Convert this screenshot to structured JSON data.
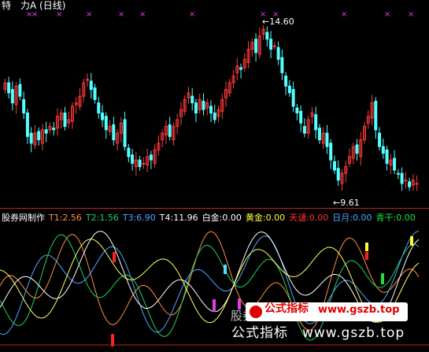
{
  "top_title": "特　力A (日线)",
  "high_label": "14.60",
  "low_label": "9.61",
  "indicator_header": [
    {
      "text": "股券网制作",
      "color": "#ffffff"
    },
    {
      "text": "T1:2.56",
      "color": "#ff9040"
    },
    {
      "text": "T2:1.56",
      "color": "#20d060"
    },
    {
      "text": "T3:6.90",
      "color": "#4fa8ff"
    },
    {
      "text": "T4:11.96",
      "color": "#ffffff"
    },
    {
      "text": "白金:0.00",
      "color": "#ffffff"
    },
    {
      "text": "黄金:0.00",
      "color": "#ffff40"
    },
    {
      "text": "天谴:0.00",
      "color": "#ff3030"
    },
    {
      "text": "日月:0.00",
      "color": "#4fa8ff"
    },
    {
      "text": "青干:0.00",
      "color": "#20e040"
    }
  ],
  "chart_data": {
    "type": "candlestick",
    "price_high": 14.6,
    "price_low": 9.61,
    "closes": [
      12.9,
      12.6,
      12.3,
      12.8,
      12.5,
      12.0,
      11.3,
      11.1,
      11.4,
      11.2,
      11.5,
      11.4,
      11.6,
      11.5,
      11.9,
      12.0,
      11.6,
      11.8,
      12.2,
      12.3,
      12.5,
      12.9,
      13.0,
      12.7,
      12.4,
      12.0,
      11.8,
      11.5,
      11.6,
      11.2,
      11.4,
      11.7,
      11.0,
      10.7,
      10.5,
      10.6,
      10.4,
      10.5,
      10.7,
      10.6,
      10.9,
      11.1,
      11.4,
      11.6,
      11.3,
      11.6,
      11.8,
      12.1,
      12.4,
      12.6,
      12.3,
      12.0,
      12.4,
      12.1,
      12.3,
      12.0,
      11.8,
      12.1,
      12.4,
      12.7,
      12.9,
      13.1,
      13.4,
      13.3,
      13.6,
      13.9,
      14.1,
      13.8,
      14.3,
      14.5,
      14.2,
      13.9,
      14.0,
      13.6,
      13.2,
      12.8,
      12.6,
      12.2,
      12.0,
      11.7,
      11.4,
      11.8,
      12.0,
      11.5,
      11.2,
      11.4,
      11.0,
      10.6,
      10.3,
      10.0,
      10.2,
      10.4,
      10.7,
      11.0,
      10.8,
      11.2,
      11.6,
      11.9,
      12.3,
      11.5,
      11.0,
      10.8,
      10.5,
      10.6,
      10.3,
      10.2,
      9.9,
      10.0,
      9.8,
      10.0,
      9.9
    ]
  },
  "watermark": {
    "badge_text": "公式指标",
    "url": "www.gszb.top",
    "under_text": "公式指标　www.gszb.top",
    "behind_text": "股券网制作"
  }
}
